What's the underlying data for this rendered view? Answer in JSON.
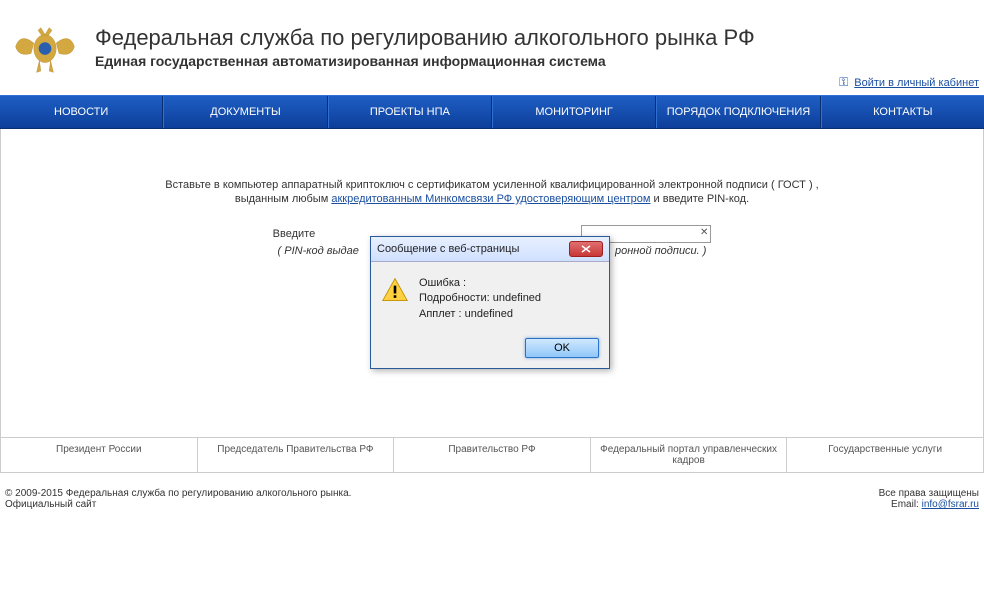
{
  "header": {
    "title1": "Федеральная служба по регулированию алкогольного рынка РФ",
    "title2": "Единая государственная автоматизированная информационная система",
    "login_link": "Войти в личный кабинет"
  },
  "nav": {
    "items": [
      "НОВОСТИ",
      "ДОКУМЕНТЫ",
      "ПРОЕКТЫ НПА",
      "МОНИТОРИНГ",
      "ПОРЯДОК ПОДКЛЮЧЕНИЯ",
      "КОНТАКТЫ"
    ]
  },
  "main": {
    "line1_pre": "Вставьте в компьютер аппаратный криптоключ с сертификатом усиленной квалифицированной электронной подписи ( ГОСТ ) ,",
    "line2_pre": "выданным любым ",
    "line2_link": "аккредитованным Минкомсвязи РФ удостоверяющим центром",
    "line2_post": " и введите PIN-код.",
    "pin_label": "Введите",
    "pin_note": "( PIN-код выдае",
    "pin_note_tail": "ронной подписи. )"
  },
  "modal": {
    "title": "Сообщение с веб-страницы",
    "line1": "Ошибка :",
    "line2": "Подробности: undefined",
    "line3": "Апплет : undefined",
    "ok": "OK"
  },
  "footer": {
    "links": [
      "Президент России",
      "Председатель Правительства РФ",
      "Правительство РФ",
      "Федеральный портал управленческих кадров",
      "Государственные услуги"
    ]
  },
  "bottom": {
    "copyright1": "© 2009-2015 Федеральная служба по регулированию алкогольного рынка.",
    "copyright2": "Официальный сайт",
    "rights": "Все права защищены",
    "email_label": "Email: ",
    "email": "info@fsrar.ru"
  }
}
